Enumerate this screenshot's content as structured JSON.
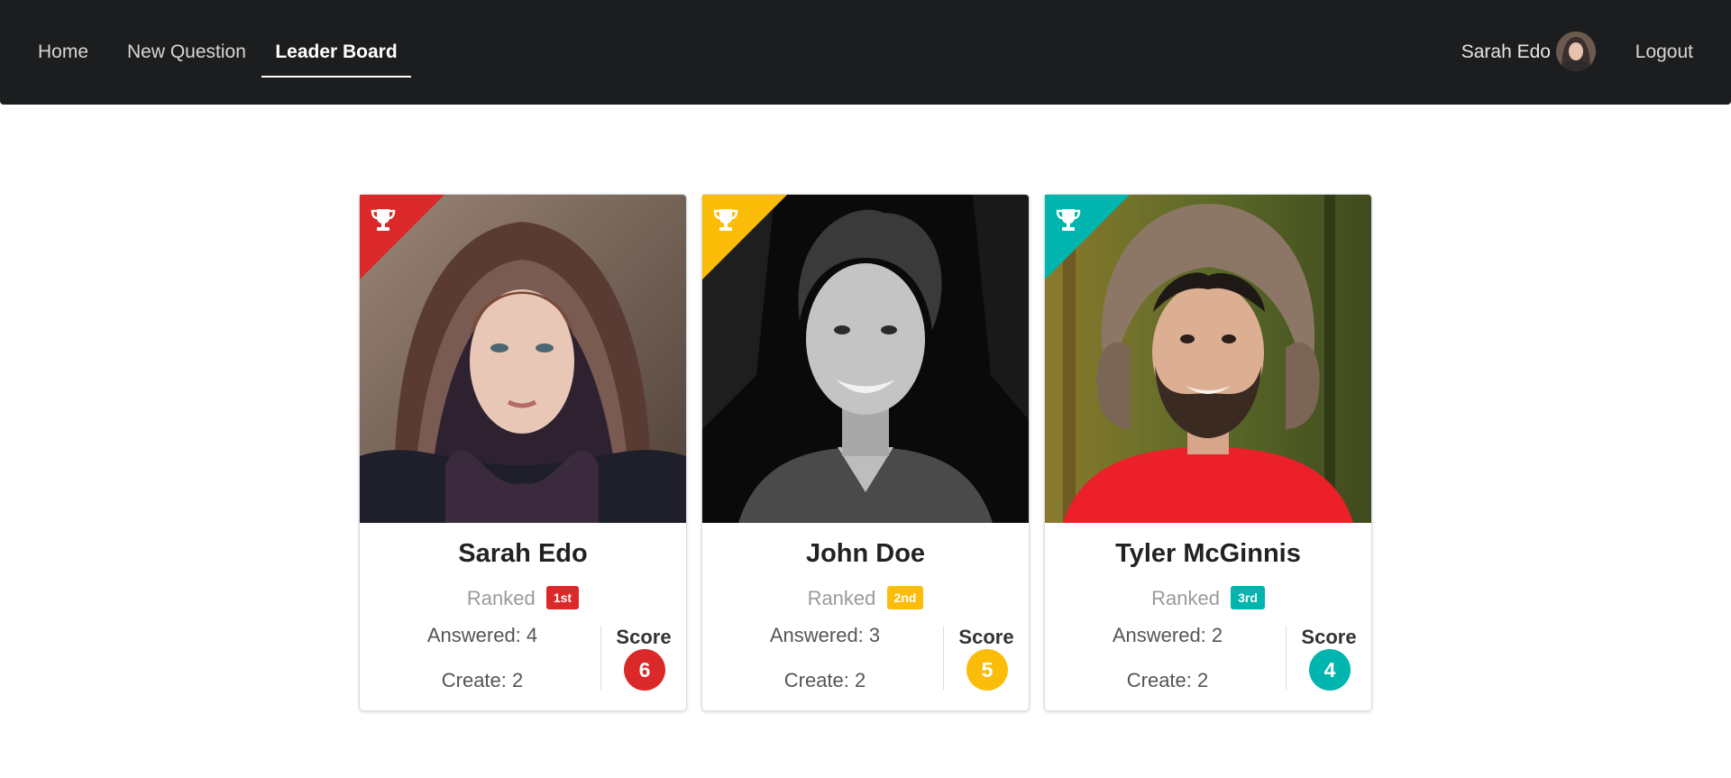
{
  "nav": {
    "home": "Home",
    "new_question": "New Question",
    "leader_board": "Leader Board",
    "user_name": "Sarah Edo",
    "avatar_icon": "user-avatar",
    "logout": "Logout"
  },
  "colors": {
    "navbar_bg": "#1c1d1f",
    "first": "#db2828",
    "second": "#fbbd08",
    "third": "#00b5ad"
  },
  "leaderboard": [
    {
      "name": "Sarah Edo",
      "ranked_label": "Ranked",
      "rank": "1st",
      "answered": "Answered: 4",
      "created": "Create: 2",
      "score_label": "Score",
      "score": "6",
      "color": "#db2828",
      "icon": "trophy-icon"
    },
    {
      "name": "John Doe",
      "ranked_label": "Ranked",
      "rank": "2nd",
      "answered": "Answered: 3",
      "created": "Create: 2",
      "score_label": "Score",
      "score": "5",
      "color": "#fbbd08",
      "icon": "trophy-icon"
    },
    {
      "name": "Tyler McGinnis",
      "ranked_label": "Ranked",
      "rank": "3rd",
      "answered": "Answered: 2",
      "created": "Create: 2",
      "score_label": "Score",
      "score": "4",
      "color": "#00b5ad",
      "icon": "trophy-icon"
    }
  ]
}
